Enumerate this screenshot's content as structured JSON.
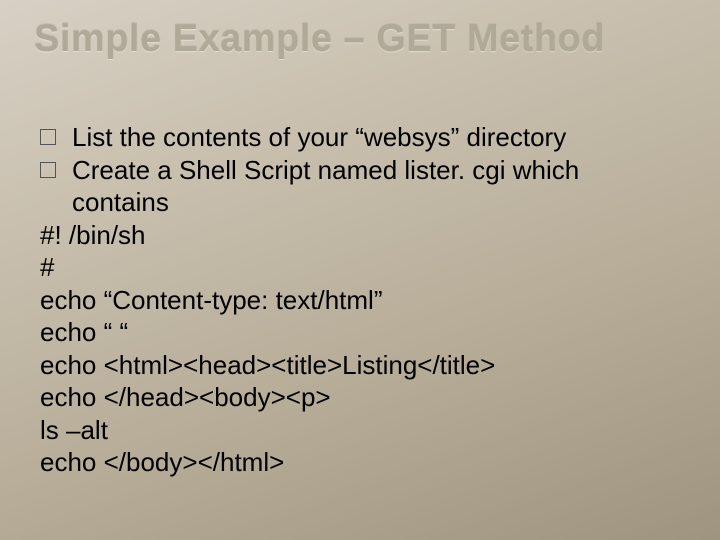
{
  "title": "Simple Example – GET Method",
  "bullets": [
    "List the contents of your “websys” directory",
    "Create a Shell Script named lister. cgi which contains"
  ],
  "code_lines": [
    "#! /bin/sh",
    "#",
    "echo “Content-type: text/html”",
    "echo “ “",
    "echo <html><head><title>Listing</title>",
    "echo </head><body><p>",
    "ls –alt",
    "echo </body></html>"
  ]
}
